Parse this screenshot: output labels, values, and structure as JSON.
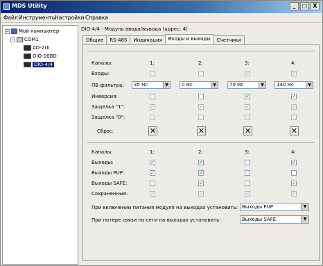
{
  "window": {
    "title": "MDS Utility",
    "controls": [
      "_",
      "□",
      "X"
    ]
  },
  "menu": [
    "Файл",
    "Инструменты",
    "Настройки",
    "Справка"
  ],
  "tree": {
    "root": "Мой компьютер",
    "port": "COM1",
    "devices": [
      "AO-2UI",
      "DIO-16BD",
      "DIO-4/4"
    ],
    "selected": "DIO-4/4"
  },
  "header": "DIO-4/4 - Модуль ввода/вывода (адрес: 4)",
  "tabs": [
    "Общие",
    "RS-485",
    "Индикация",
    "Входы и выходы",
    "Счетчики"
  ],
  "active_tab": "Входы и выходы",
  "inputs": {
    "channels_label": "Каналы:",
    "channels": [
      "1:",
      "2:",
      "3:",
      "4:"
    ],
    "rows": [
      {
        "label": "Входы:",
        "values": [
          false,
          false,
          true,
          true
        ],
        "disabled": true
      },
      {
        "label": "Инверсия:",
        "values": [
          false,
          false,
          true,
          true
        ],
        "disabled": false
      },
      {
        "label": "Защелка \"1\":",
        "values": [
          true,
          true,
          true,
          true
        ],
        "disabled": true
      },
      {
        "label": "Защелка \"0\":",
        "values": [
          false,
          false,
          false,
          false
        ],
        "disabled": true
      }
    ],
    "filter_label": "ПВ фильтра:",
    "filter_values": [
      "35 мс",
      "0 мс",
      "70 мс",
      "140 мс"
    ],
    "reset_label": "Сброс:"
  },
  "outputs": {
    "channels_label": "Каналы:",
    "channels": [
      "1:",
      "2:",
      "3:",
      "4:"
    ],
    "rows": [
      {
        "label": "Выходы:",
        "values": [
          true,
          true,
          false,
          true
        ],
        "disabled": false
      },
      {
        "label": "Выходы PUP:",
        "values": [
          true,
          true,
          false,
          false
        ],
        "disabled": false
      },
      {
        "label": "Выходы SAFE:",
        "values": [
          false,
          true,
          false,
          true
        ],
        "disabled": false
      },
      {
        "label": "Сохраненные:",
        "values": [
          true,
          true,
          true,
          true
        ],
        "disabled": true
      }
    ]
  },
  "power_on_label": "При включении питания модуля на выходах установить:",
  "power_on_value": "Выходы PUP",
  "link_loss_label": "При потере связи по сети на выходах установить:",
  "link_loss_value": "Выходы SAFE"
}
